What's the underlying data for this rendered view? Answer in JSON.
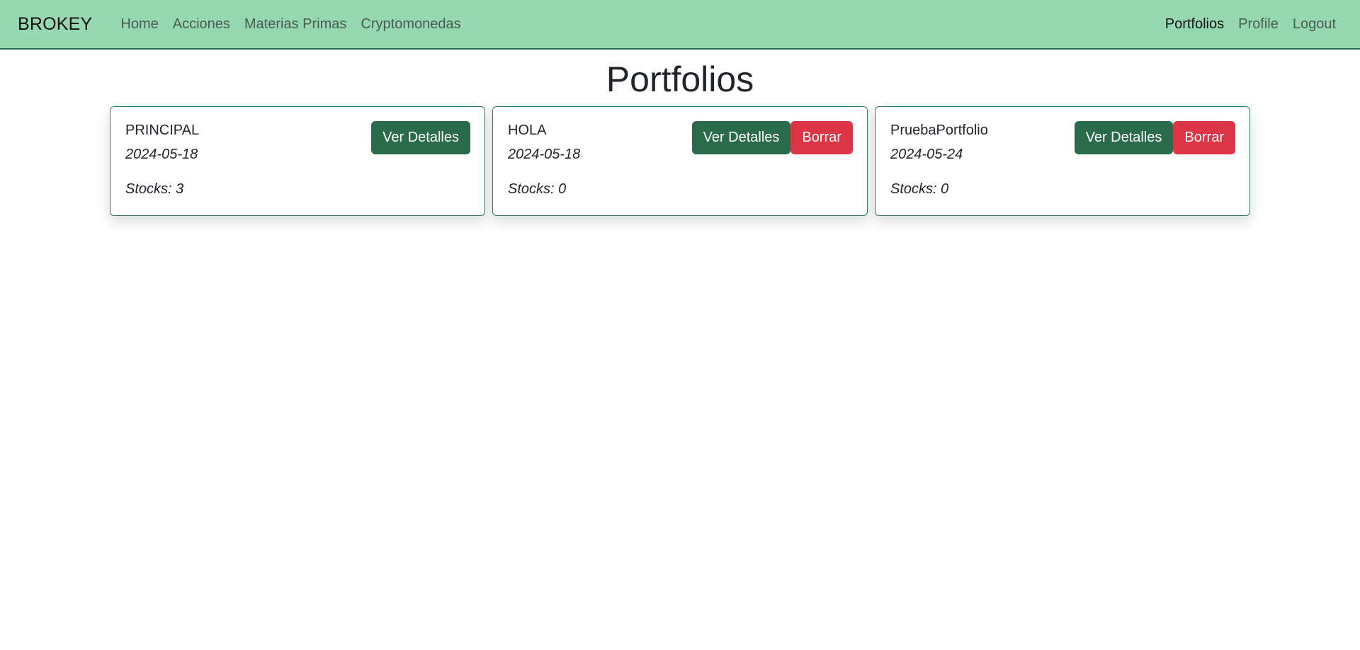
{
  "navbar": {
    "brand": "BROKEY",
    "left_links": [
      "Home",
      "Acciones",
      "Materias Primas",
      "Cryptomonedas"
    ],
    "right_links": [
      "Portfolios",
      "Profile",
      "Logout"
    ],
    "active": "Portfolios"
  },
  "page": {
    "title": "Portfolios"
  },
  "portfolios": [
    {
      "name": "PRINCIPAL",
      "date": "2024-05-18",
      "stocks": "Stocks: 3",
      "details_label": "Ver Detalles",
      "delete_label": ""
    },
    {
      "name": "HOLA",
      "date": "2024-05-18",
      "stocks": "Stocks: 0",
      "details_label": "Ver Detalles",
      "delete_label": "Borrar"
    },
    {
      "name": "PruebaPortfolio",
      "date": "2024-05-24",
      "stocks": "Stocks: 0",
      "details_label": "Ver Detalles",
      "delete_label": "Borrar"
    }
  ],
  "colors": {
    "navbar_bg": "#96d8b1",
    "primary_button": "#2a6b4c",
    "danger_button": "#dc3545"
  }
}
